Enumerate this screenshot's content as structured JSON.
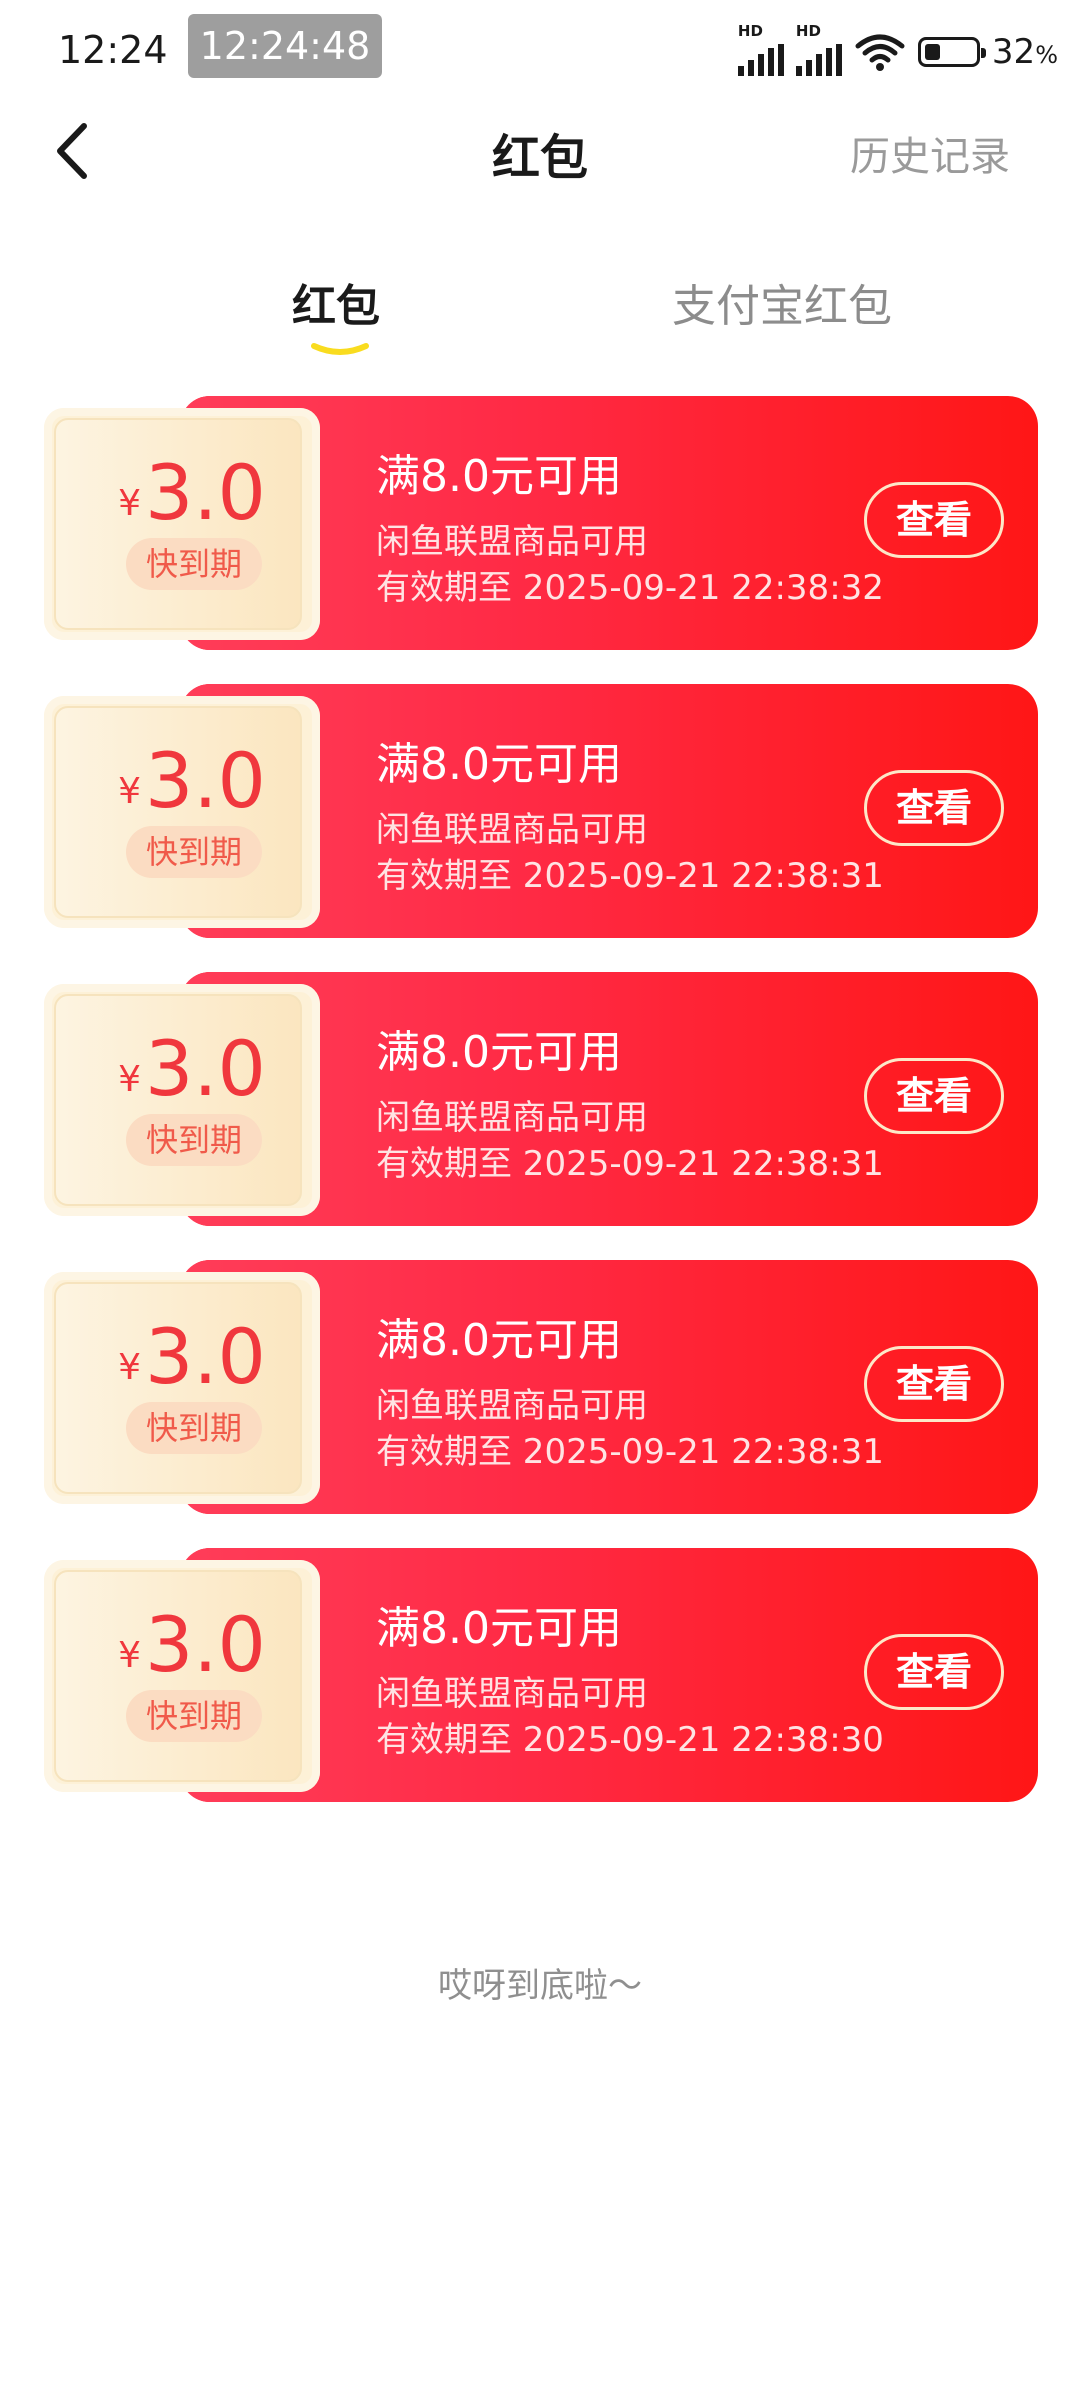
{
  "status_bar": {
    "time": "12:24",
    "clock_overlay": "12:24:48",
    "network_1": "HD",
    "network_2": "HD",
    "battery_percent": "32",
    "battery_unit": "%",
    "battery_level": 0.32,
    "icons": [
      "signal-icon",
      "signal-icon",
      "wifi-icon",
      "battery-icon"
    ]
  },
  "navbar": {
    "back_icon": "chevron-left-icon",
    "title": "红包",
    "history_label": "历史记录"
  },
  "tabs": [
    {
      "label": "红包",
      "active": true
    },
    {
      "label": "支付宝红包",
      "active": false
    }
  ],
  "colors": {
    "accent_yellow": "#f9dc1f",
    "coupon_red": "#ff1616",
    "coupon_pink": "#ff3d59",
    "amount_red": "#f0373d"
  },
  "coupons": [
    {
      "currency": "¥",
      "amount": "3.0",
      "badge": "快到期",
      "condition": "满8.0元可用",
      "scope": "闲鱼联盟商品可用",
      "validity": "有效期至 2025-09-21 22:38:32",
      "button": "查看"
    },
    {
      "currency": "¥",
      "amount": "3.0",
      "badge": "快到期",
      "condition": "满8.0元可用",
      "scope": "闲鱼联盟商品可用",
      "validity": "有效期至 2025-09-21 22:38:31",
      "button": "查看"
    },
    {
      "currency": "¥",
      "amount": "3.0",
      "badge": "快到期",
      "condition": "满8.0元可用",
      "scope": "闲鱼联盟商品可用",
      "validity": "有效期至 2025-09-21 22:38:31",
      "button": "查看"
    },
    {
      "currency": "¥",
      "amount": "3.0",
      "badge": "快到期",
      "condition": "满8.0元可用",
      "scope": "闲鱼联盟商品可用",
      "validity": "有效期至 2025-09-21 22:38:31",
      "button": "查看"
    },
    {
      "currency": "¥",
      "amount": "3.0",
      "badge": "快到期",
      "condition": "满8.0元可用",
      "scope": "闲鱼联盟商品可用",
      "validity": "有效期至 2025-09-21 22:38:30",
      "button": "查看"
    }
  ],
  "footer": {
    "end_text": "哎呀到底啦～"
  }
}
